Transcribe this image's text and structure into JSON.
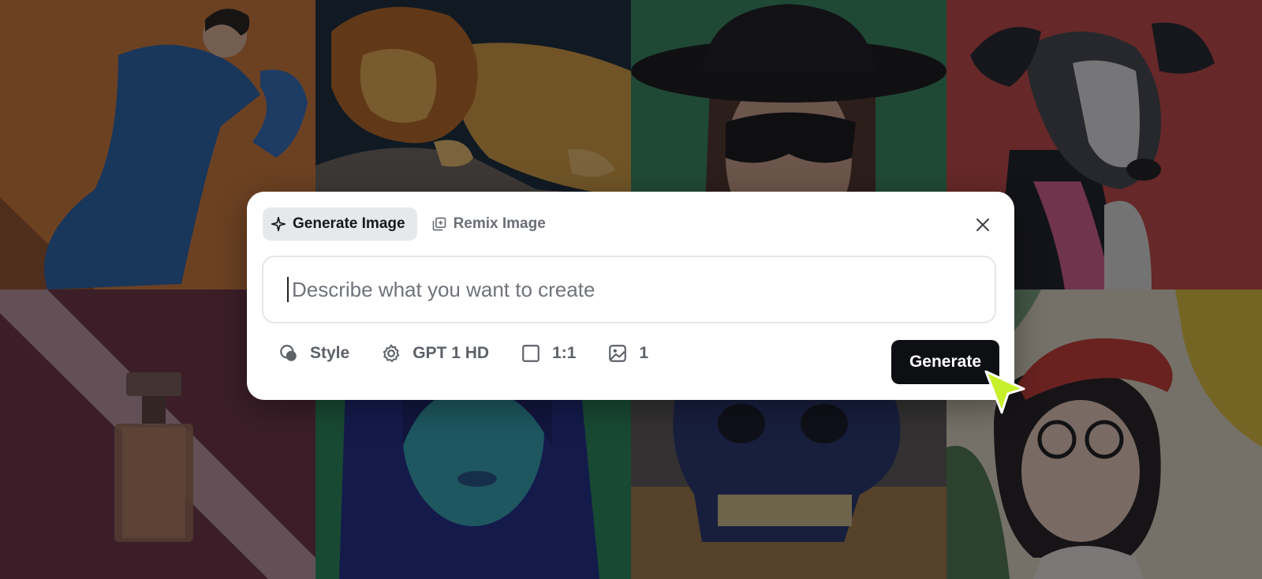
{
  "gallery": {
    "images": [
      {
        "subject": "woman-blue-dress"
      },
      {
        "subject": "sleeping-lion"
      },
      {
        "subject": "masked-woman-hat"
      },
      {
        "subject": "dog-illustration"
      },
      {
        "subject": "perfume-bottle"
      },
      {
        "subject": "neon-portrait"
      },
      {
        "subject": "crystal-skull"
      },
      {
        "subject": "girl-red-beret"
      }
    ]
  },
  "dialog": {
    "tabs": [
      {
        "label": "Generate Image",
        "icon": "sparkle-icon",
        "active": true
      },
      {
        "label": "Remix Image",
        "icon": "remix-icon",
        "active": false
      }
    ],
    "close_icon": "close-icon",
    "prompt": {
      "value": "",
      "placeholder": "Describe what you want to create"
    },
    "options": [
      {
        "label": "Style",
        "icon": "palette-icon"
      },
      {
        "label": "GPT 1 HD",
        "icon": "gear-icon"
      },
      {
        "label": "1:1",
        "icon": "aspect-ratio-icon"
      },
      {
        "label": "1",
        "icon": "image-count-icon"
      }
    ],
    "generate_label": "Generate"
  },
  "colors": {
    "accent_button": "#0d0f12",
    "cursor": "#c7f02c",
    "active_tab_bg": "#e6e8eb"
  }
}
